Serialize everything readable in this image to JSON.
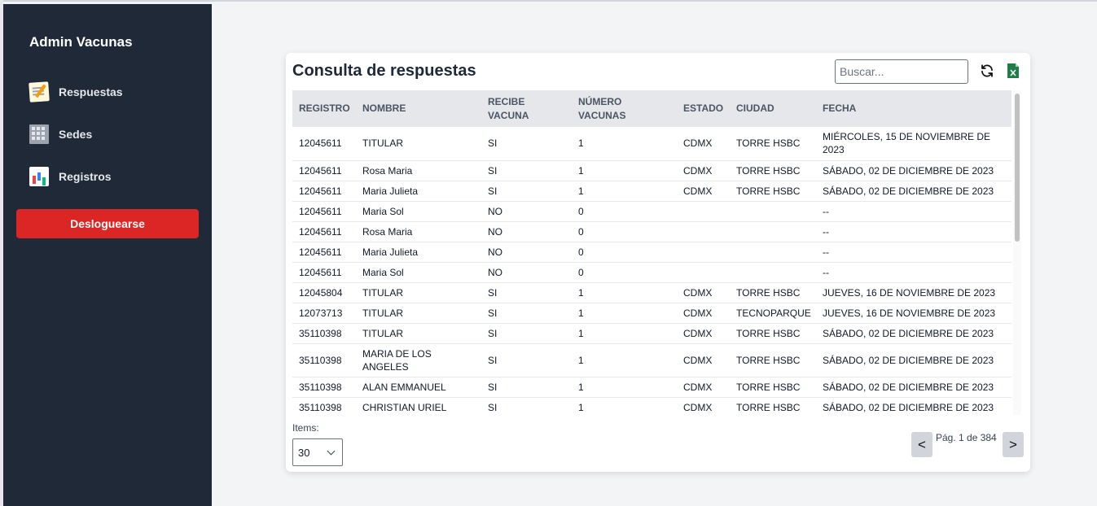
{
  "sidebar": {
    "brand": "Admin Vacunas",
    "items": [
      {
        "label": "Respuestas",
        "icon": "memo-icon"
      },
      {
        "label": "Sedes",
        "icon": "office-building-icon"
      },
      {
        "label": "Registros",
        "icon": "bar-chart-icon"
      }
    ],
    "logout_label": "Desloguearse"
  },
  "panel": {
    "title": "Consulta de respuestas",
    "search_placeholder": "Buscar...",
    "refresh_icon": "refresh-icon",
    "export_icon": "excel-export-icon"
  },
  "table": {
    "headers": [
      "REGISTRO",
      "NOMBRE",
      "RECIBE VACUNA",
      "NÚMERO VACUNAS",
      "ESTADO",
      "CIUDAD",
      "FECHA"
    ],
    "rows": [
      [
        "12045611",
        "TITULAR",
        "SI",
        "1",
        "CDMX",
        "TORRE HSBC",
        "MIÉRCOLES, 15 DE NOVIEMBRE DE 2023"
      ],
      [
        "12045611",
        "Rosa Maria",
        "SI",
        "1",
        "CDMX",
        "TORRE HSBC",
        "SÁBADO, 02 DE DICIEMBRE DE 2023"
      ],
      [
        "12045611",
        "Maria Julieta",
        "SI",
        "1",
        "CDMX",
        "TORRE HSBC",
        "SÁBADO, 02 DE DICIEMBRE DE 2023"
      ],
      [
        "12045611",
        "Maria Sol",
        "NO",
        "0",
        "",
        "",
        "--"
      ],
      [
        "12045611",
        "Rosa Maria",
        "NO",
        "0",
        "",
        "",
        "--"
      ],
      [
        "12045611",
        "Maria Julieta",
        "NO",
        "0",
        "",
        "",
        "--"
      ],
      [
        "12045611",
        "Maria Sol",
        "NO",
        "0",
        "",
        "",
        "--"
      ],
      [
        "12045804",
        "TITULAR",
        "SI",
        "1",
        "CDMX",
        "TORRE HSBC",
        "JUEVES, 16 DE NOVIEMBRE DE 2023"
      ],
      [
        "12073713",
        "TITULAR",
        "SI",
        "1",
        "CDMX",
        "TECNOPARQUE",
        "JUEVES, 16 DE NOVIEMBRE DE 2023"
      ],
      [
        "35110398",
        "TITULAR",
        "SI",
        "1",
        "CDMX",
        "TORRE HSBC",
        "SÁBADO, 02 DE DICIEMBRE DE 2023"
      ],
      [
        "35110398",
        "MARIA DE LOS ANGELES",
        "SI",
        "1",
        "CDMX",
        "TORRE HSBC",
        "SÁBADO, 02 DE DICIEMBRE DE 2023"
      ],
      [
        "35110398",
        "ALAN EMMANUEL",
        "SI",
        "1",
        "CDMX",
        "TORRE HSBC",
        "SÁBADO, 02 DE DICIEMBRE DE 2023"
      ],
      [
        "35110398",
        "CHRISTIAN URIEL",
        "SI",
        "1",
        "CDMX",
        "TORRE HSBC",
        "SÁBADO, 02 DE DICIEMBRE DE 2023"
      ]
    ]
  },
  "footer": {
    "items_label": "Items:",
    "items_value": "30",
    "prev_label": "<",
    "next_label": ">",
    "page_info": "Pág. 1 de 384"
  },
  "colors": {
    "sidebar_bg": "#1f2937",
    "logout_bg": "#dc2626",
    "page_bg": "#f3f4f6",
    "header_bg": "#e5e7eb"
  }
}
